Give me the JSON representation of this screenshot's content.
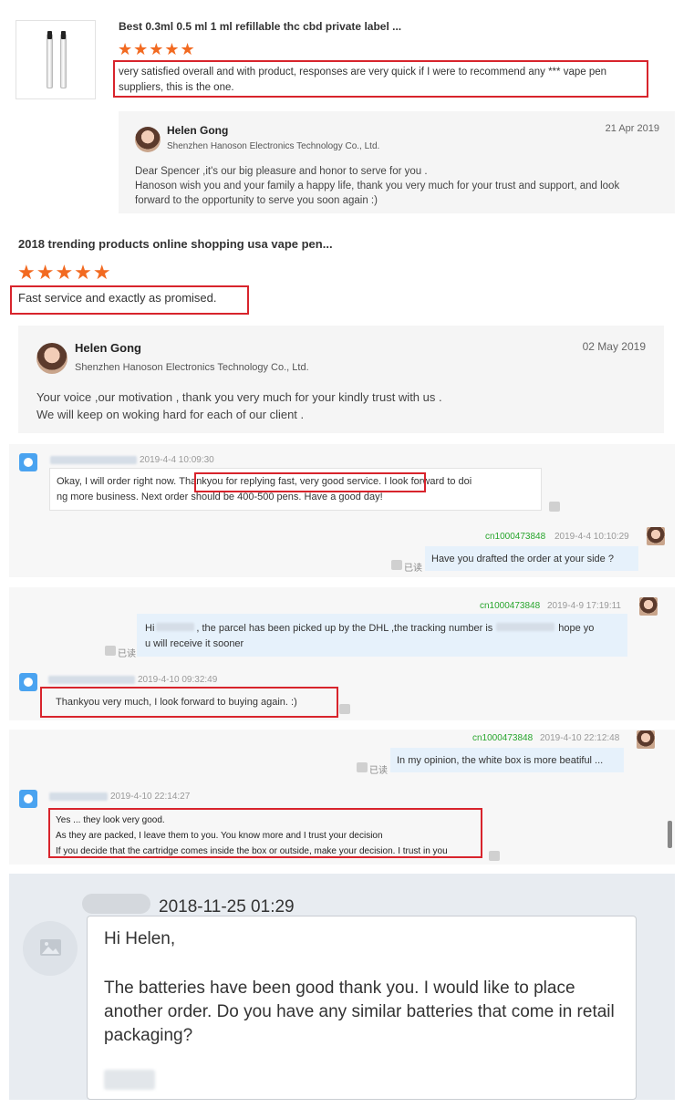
{
  "review1": {
    "title": "Best 0.3ml 0.5 ml 1 ml refillable thc cbd private label ...",
    "stars": "★★★★★",
    "comment": "very satisfied overall and with product, responses are very quick if I were to recommend any *** vape pen suppliers, this is the one.",
    "reply": {
      "name": "Helen Gong",
      "company": "Shenzhen Hanoson Electronics Technology Co., Ltd.",
      "date": "21 Apr 2019",
      "line1": "Dear Spencer ,it's our big pleasure and honor to serve for you .",
      "line2": "Hanoson wish you and your family a happy life, thank you very much for your trust and support, and look",
      "line3": "forward to the opportunity to serve you soon again :)"
    }
  },
  "review2": {
    "title": "2018 trending products online shopping usa vape pen...",
    "stars": "★★★★★",
    "comment": "Fast service and exactly as promised.",
    "reply": {
      "name": "Helen Gong",
      "company": "Shenzhen Hanoson Electronics Technology Co., Ltd.",
      "date": "02 May 2019",
      "line1": "Your voice ,our motivation , thank you very much for your kindly trust with us .",
      "line2": "We will keep on woking hard for each of our client ."
    }
  },
  "chat1": {
    "in_time": "2019-4-4 10:09:30",
    "in_part1": "Okay, I will order right now.",
    "in_highlight": "Thankyou for replying fast, very good service",
    "in_part2": ". I look forward to doi",
    "in_line2": "ng more business. Next order should be 400-500 pens. Have a good day!",
    "out_user": "cn1000473848",
    "out_time": "2019-4-4 10:10:29",
    "out_text": "Have you drafted the order at your side ?",
    "read": "已读"
  },
  "chat2": {
    "out_user": "cn1000473848",
    "out_time": "2019-4-9 17:19:11",
    "out_hi": "Hi",
    "out_mid": ", the parcel has been picked up by the DHL ,the tracking number is",
    "out_end": "hope yo",
    "out_line2": "u will receive it sooner",
    "read": "已读",
    "in_time": "2019-4-10 09:32:49",
    "in_text": "Thankyou very much, I look forward to buying again. :)"
  },
  "chat3": {
    "out_user": "cn1000473848",
    "out_time": "2019-4-10 22:12:48",
    "out_text": "In my opinion, the white box is more beatiful ...",
    "read": "已读",
    "in_time": "2019-4-10 22:14:27",
    "in_line1": "Yes ... they look very good.",
    "in_line2": "As they are packed, I leave them to you. You know more and I trust your decision",
    "in_line3": "If you decide that the cartridge comes inside the box or outside, make your decision. I trust in you"
  },
  "email": {
    "date": "2018-11-25 01:29",
    "greeting": "Hi Helen,",
    "body": "The batteries have been good thank you. I would like to place another order. Do you have any similar batteries that come in retail packaging?"
  },
  "colors": {
    "highlight_red": "#d8242c",
    "star_orange": "#f26a21",
    "online_green": "#27a52c",
    "bubble_blue": "#e6f1fb"
  }
}
